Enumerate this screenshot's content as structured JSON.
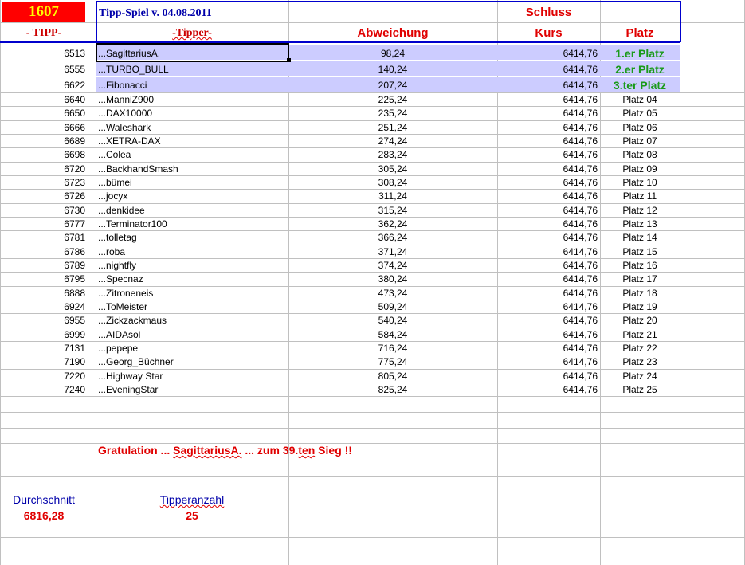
{
  "header": {
    "id": "1607",
    "title": "Tipp-Spiel v. 04.08.2011",
    "schluss": "Schluss",
    "col_tipp": "- TIPP-",
    "col_tipper": "-Tipper-",
    "col_abweichung": "Abweichung",
    "col_kurs": "Kurs",
    "col_platz": "Platz"
  },
  "rows": [
    {
      "tipp": "6513",
      "tipper": "...SagittariusA.",
      "abw": "98,24",
      "kurs": "6414,76",
      "platz": "1.er Platz"
    },
    {
      "tipp": "6555",
      "tipper": "...TURBO_BULL",
      "abw": "140,24",
      "kurs": "6414,76",
      "platz": "2.er Platz"
    },
    {
      "tipp": "6622",
      "tipper": "...Fibonacci",
      "abw": "207,24",
      "kurs": "6414,76",
      "platz": "3.ter Platz"
    },
    {
      "tipp": "6640",
      "tipper": "...ManniZ900",
      "abw": "225,24",
      "kurs": "6414,76",
      "platz": "Platz 04"
    },
    {
      "tipp": "6650",
      "tipper": "...DAX10000",
      "abw": "235,24",
      "kurs": "6414,76",
      "platz": "Platz 05"
    },
    {
      "tipp": "6666",
      "tipper": "...Waleshark",
      "abw": "251,24",
      "kurs": "6414,76",
      "platz": "Platz 06"
    },
    {
      "tipp": "6689",
      "tipper": "...XETRA-DAX",
      "abw": "274,24",
      "kurs": "6414,76",
      "platz": "Platz 07"
    },
    {
      "tipp": "6698",
      "tipper": "...Colea",
      "abw": "283,24",
      "kurs": "6414,76",
      "platz": "Platz 08"
    },
    {
      "tipp": "6720",
      "tipper": "...BackhandSmash",
      "abw": "305,24",
      "kurs": "6414,76",
      "platz": "Platz 09"
    },
    {
      "tipp": "6723",
      "tipper": "...bümei",
      "abw": "308,24",
      "kurs": "6414,76",
      "platz": "Platz 10"
    },
    {
      "tipp": "6726",
      "tipper": "...jocyx",
      "abw": "311,24",
      "kurs": "6414,76",
      "platz": "Platz 11"
    },
    {
      "tipp": "6730",
      "tipper": "...denkidee",
      "abw": "315,24",
      "kurs": "6414,76",
      "platz": "Platz 12"
    },
    {
      "tipp": "6777",
      "tipper": "...Terminator100",
      "abw": "362,24",
      "kurs": "6414,76",
      "platz": "Platz 13"
    },
    {
      "tipp": "6781",
      "tipper": "...tolletag",
      "abw": "366,24",
      "kurs": "6414,76",
      "platz": "Platz 14"
    },
    {
      "tipp": "6786",
      "tipper": "...roba",
      "abw": "371,24",
      "kurs": "6414,76",
      "platz": "Platz 15"
    },
    {
      "tipp": "6789",
      "tipper": "...nightfly",
      "abw": "374,24",
      "kurs": "6414,76",
      "platz": "Platz 16"
    },
    {
      "tipp": "6795",
      "tipper": "...Specnaz",
      "abw": "380,24",
      "kurs": "6414,76",
      "platz": "Platz 17"
    },
    {
      "tipp": "6888",
      "tipper": "...Zitroneneis",
      "abw": "473,24",
      "kurs": "6414,76",
      "platz": "Platz 18"
    },
    {
      "tipp": "6924",
      "tipper": "...ToMeister",
      "abw": "509,24",
      "kurs": "6414,76",
      "platz": "Platz 19"
    },
    {
      "tipp": "6955",
      "tipper": "...Zickzackmaus",
      "abw": "540,24",
      "kurs": "6414,76",
      "platz": "Platz 20"
    },
    {
      "tipp": "6999",
      "tipper": "...AIDAsol",
      "abw": "584,24",
      "kurs": "6414,76",
      "platz": "Platz 21"
    },
    {
      "tipp": "7131",
      "tipper": "...pepepe",
      "abw": "716,24",
      "kurs": "6414,76",
      "platz": "Platz 22"
    },
    {
      "tipp": "7190",
      "tipper": "...Georg_Büchner",
      "abw": "775,24",
      "kurs": "6414,76",
      "platz": "Platz 23"
    },
    {
      "tipp": "7220",
      "tipper": "...Highway Star",
      "abw": "805,24",
      "kurs": "6414,76",
      "platz": "Platz 24"
    },
    {
      "tipp": "7240",
      "tipper": "...EveningStar",
      "abw": "825,24",
      "kurs": "6414,76",
      "platz": "Platz 25"
    }
  ],
  "congrats": {
    "a": "Gratulation ... ",
    "name": "SagittariusA.",
    "b": " ... zum  39.",
    "ten": "ten",
    "c": "  Sieg  !!"
  },
  "stats": {
    "avg_label": "Durchschnitt",
    "avg_value": "6816,28",
    "count_label": "Tipperanzahl",
    "count_value": "25"
  },
  "colors": {
    "accent_red": "#e00000",
    "header_blue": "#0000cc",
    "highlight": "#ccccff",
    "winner_green": "#1a9a1a"
  }
}
